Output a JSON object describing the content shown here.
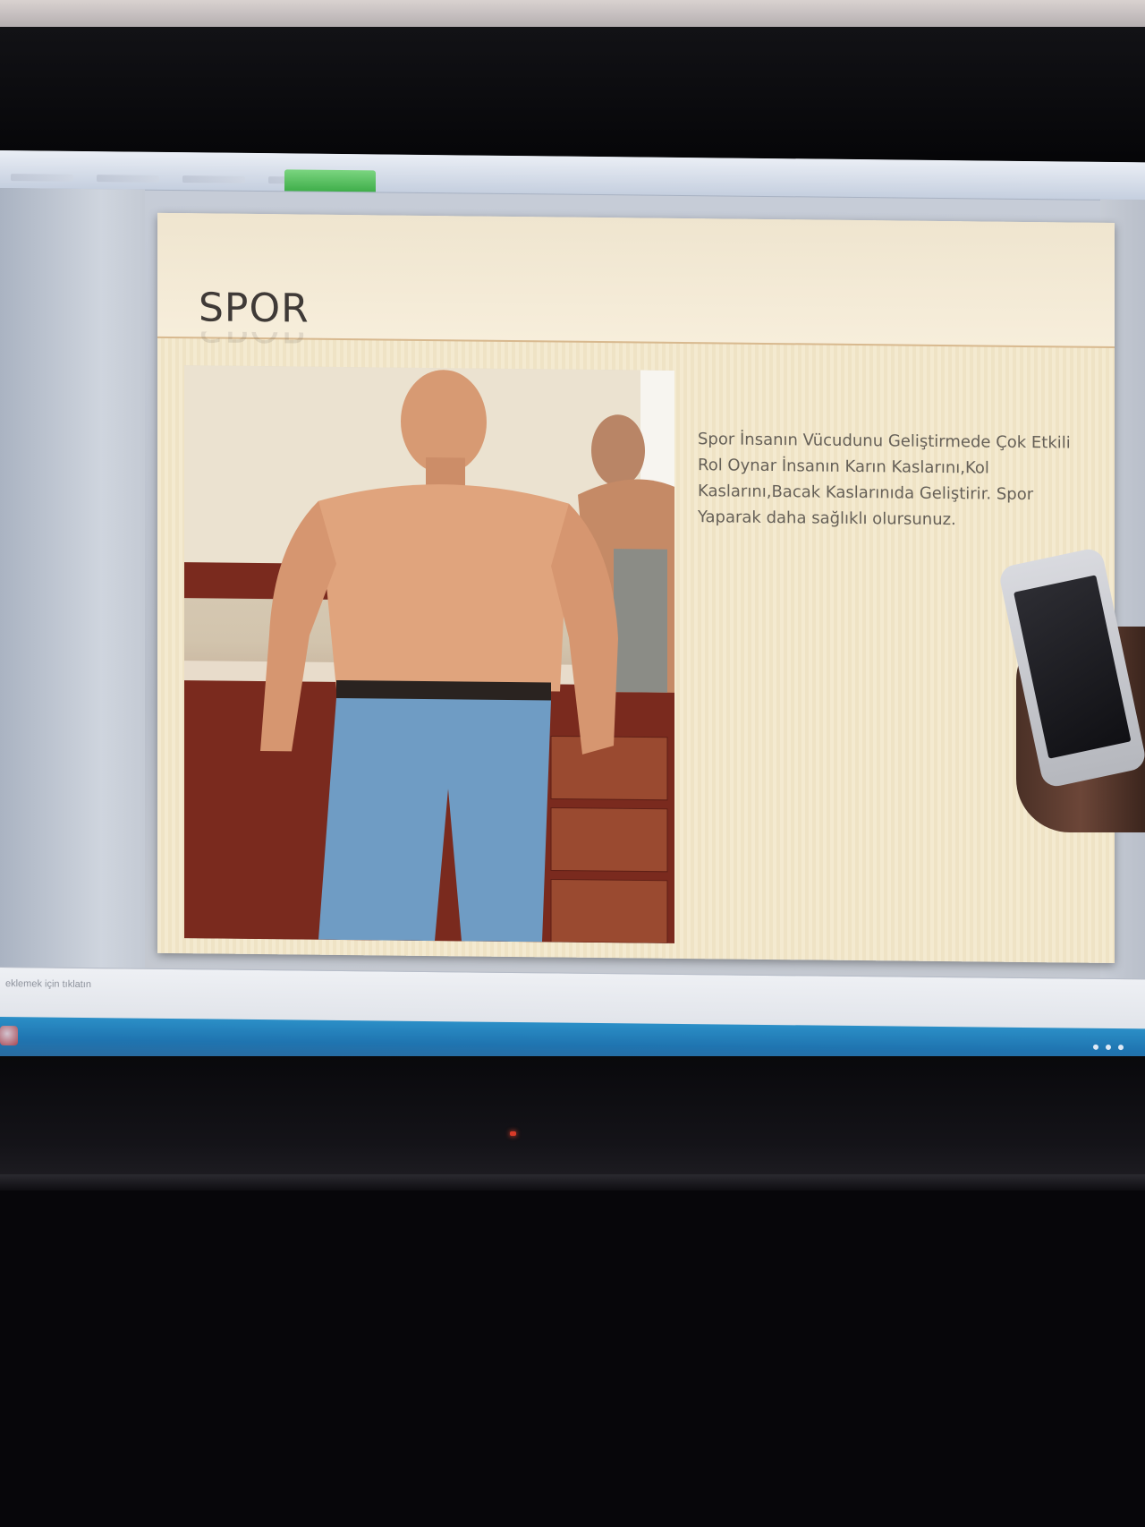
{
  "slide": {
    "title": "SPOR",
    "body": "Spor İnsanın Vücudunu Geliştirmede Çok Etkili Rol Oynar İnsanın Karın Kaslarını,Kol Kaslarını,Bacak Kaslarınıda Geliştirir. Spor Yaparak daha sağlıklı olursunuz."
  },
  "status_bar": {
    "notes_hint": "eklemek için tıklatın"
  },
  "icons": {
    "start": "windows-start-icon",
    "tray": "system-tray-icon"
  },
  "colors": {
    "context_tab": "#3fae4a",
    "taskbar": "#1f74b0",
    "slide_background": "#f4ead0",
    "title_text": "#3f3a37"
  }
}
